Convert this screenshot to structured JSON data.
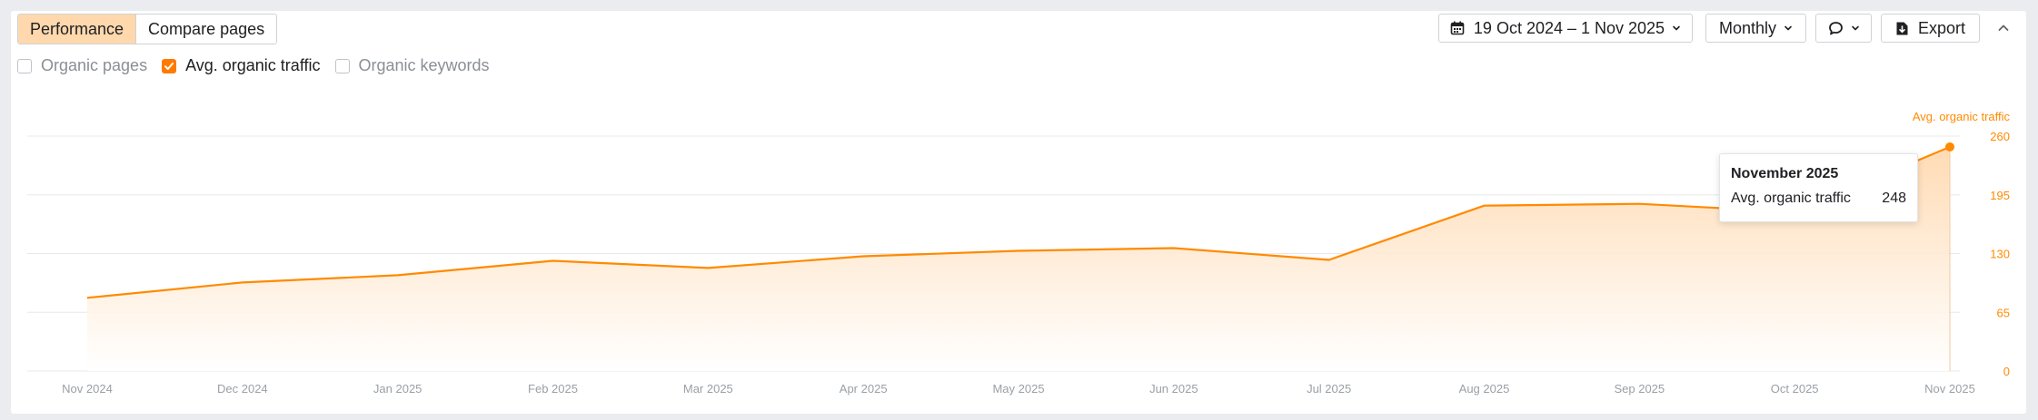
{
  "tabs": [
    {
      "label": "Performance",
      "active": true
    },
    {
      "label": "Compare pages",
      "active": false
    }
  ],
  "metrics": [
    {
      "label": "Organic pages",
      "checked": false
    },
    {
      "label": "Avg. organic traffic",
      "checked": true
    },
    {
      "label": "Organic keywords",
      "checked": false
    }
  ],
  "toolbar": {
    "date_range": "19 Oct 2024 – 1 Nov 2025",
    "interval": "Monthly",
    "export_label": "Export",
    "icons": [
      "calendar-icon",
      "comment-icon",
      "download-icon",
      "chevron-up-icon"
    ]
  },
  "tooltip": {
    "title": "November 2025",
    "label": "Avg. organic traffic",
    "value": "248"
  },
  "colors": {
    "accent": "#ff8a00",
    "accent_fill_top": "#ffd9b0",
    "grid": "#e8e8e8",
    "axis_text": "#9aa0a6",
    "tab_active": "#ffd8ad"
  },
  "chart_data": {
    "type": "area",
    "x": [
      "Nov 2024",
      "Dec 2024",
      "Jan 2025",
      "Feb 2025",
      "Mar 2025",
      "Apr 2025",
      "May 2025",
      "Jun 2025",
      "Jul 2025",
      "Aug 2025",
      "Sep 2025",
      "Oct 2025",
      "Nov 2025"
    ],
    "series": [
      {
        "name": "Avg. organic traffic",
        "values": [
          81,
          98,
          106,
          122,
          114,
          127,
          133,
          136,
          123,
          183,
          185,
          176,
          248
        ]
      }
    ],
    "y_axis_title": "Avg. organic traffic",
    "y_ticks": [
      0,
      65,
      130,
      195,
      260
    ],
    "y_axis_side": "right",
    "ylim": [
      0,
      260
    ],
    "grid": true,
    "legend": "none"
  }
}
